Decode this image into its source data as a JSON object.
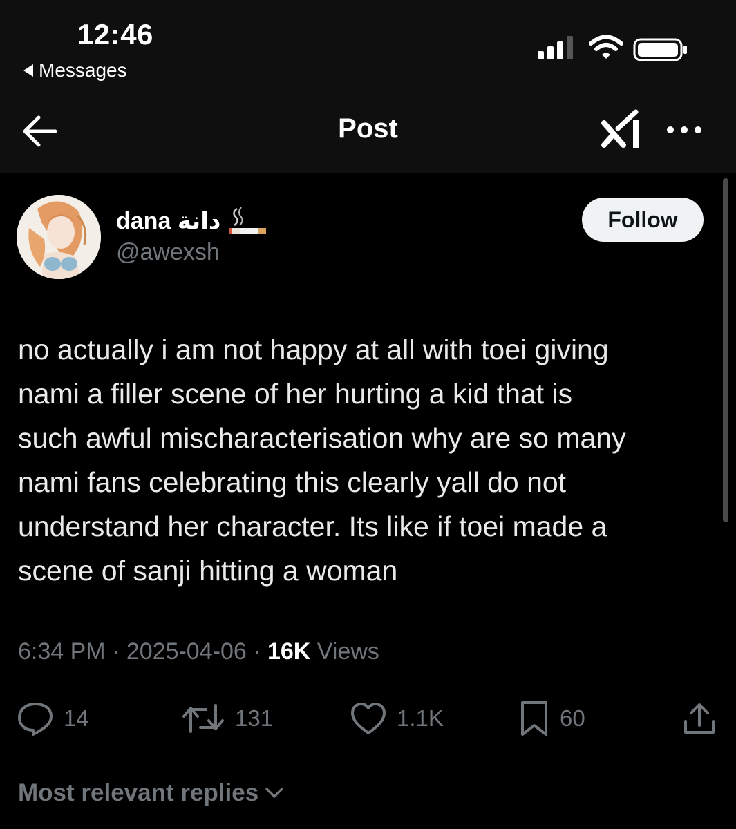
{
  "status_bar": {
    "time": "12:46",
    "back_app": "Messages"
  },
  "nav": {
    "title": "Post"
  },
  "author": {
    "display_name": "dana دانة",
    "handle": "@awexsh",
    "follow_label": "Follow",
    "name_emoji_icon": "cigarette-icon"
  },
  "post": {
    "lines": [
      "no actually i am not happy at all with toei giving",
      "nami a filler scene of her hurting a kid that is",
      "such awful mischaracterisation why are so many",
      "nami fans celebrating this clearly yall do not",
      "understand her character. Its like if toei made a",
      "scene of sanji hitting a woman"
    ],
    "time": "6:34 PM",
    "date": "2025-04-06",
    "separator": " · ",
    "views_count": "16K",
    "views_label": " Views"
  },
  "actions": {
    "replies": "14",
    "reposts": "131",
    "likes": "1.1K",
    "bookmarks": "60"
  },
  "replies_section": {
    "sort_label": "Most relevant replies"
  },
  "colors": {
    "background": "#000000",
    "header_background": "#0f0f0f",
    "text_primary": "#e7e9ea",
    "text_secondary": "#71767b",
    "follow_button": "#eff3f4"
  }
}
